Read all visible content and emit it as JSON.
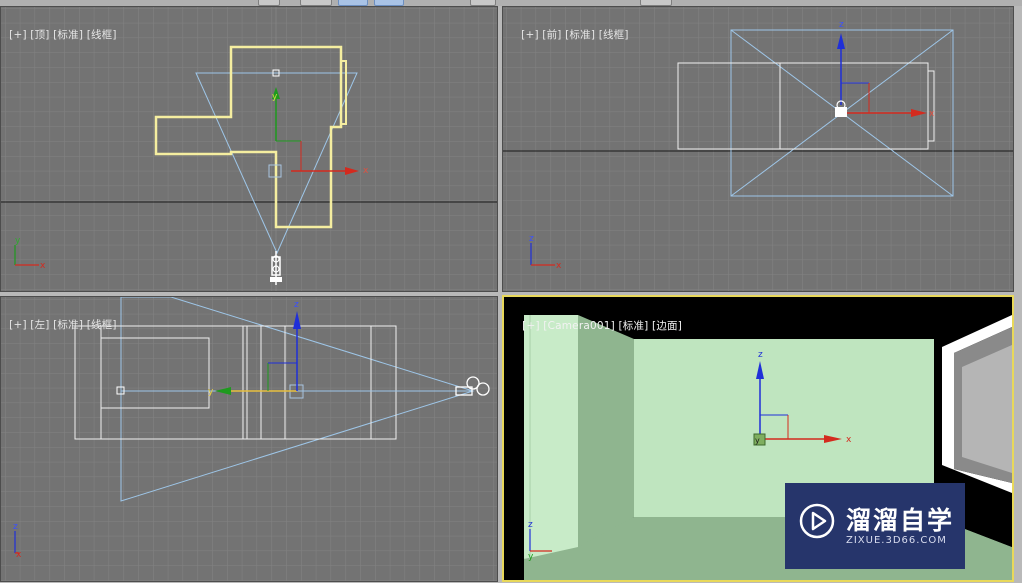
{
  "viewports": [
    {
      "id": "top",
      "label": [
        "[+]",
        "[顶]",
        "[标准]",
        "[线框]"
      ]
    },
    {
      "id": "front",
      "label": [
        "[+]",
        "[前]",
        "[标准]",
        "[线框]"
      ]
    },
    {
      "id": "left",
      "label": [
        "[+]",
        "[左]",
        "[标准]",
        "[线框]"
      ]
    },
    {
      "id": "camera",
      "label": [
        "[+]",
        "[Camera001]",
        "[标准]",
        "[边面]"
      ]
    }
  ],
  "axes": {
    "x": "x",
    "y": "y",
    "z": "z"
  },
  "watermark": {
    "title": "溜溜自学",
    "url": "ZIXUE.3D66.COM"
  },
  "colors": {
    "viewport_bg": "#737373",
    "grid": "#828282",
    "selection": "#f5eea0",
    "frustum": "#9ec6e8",
    "wire": "#f0f0f0",
    "active_border": "#e8d85a",
    "axis_x": "#d42a1e",
    "axis_y": "#1e9a1e",
    "axis_z": "#1f2fd8",
    "wall": "#bfe5bf",
    "floor": "#8fb58f",
    "watermark_bg": "#26356b"
  }
}
